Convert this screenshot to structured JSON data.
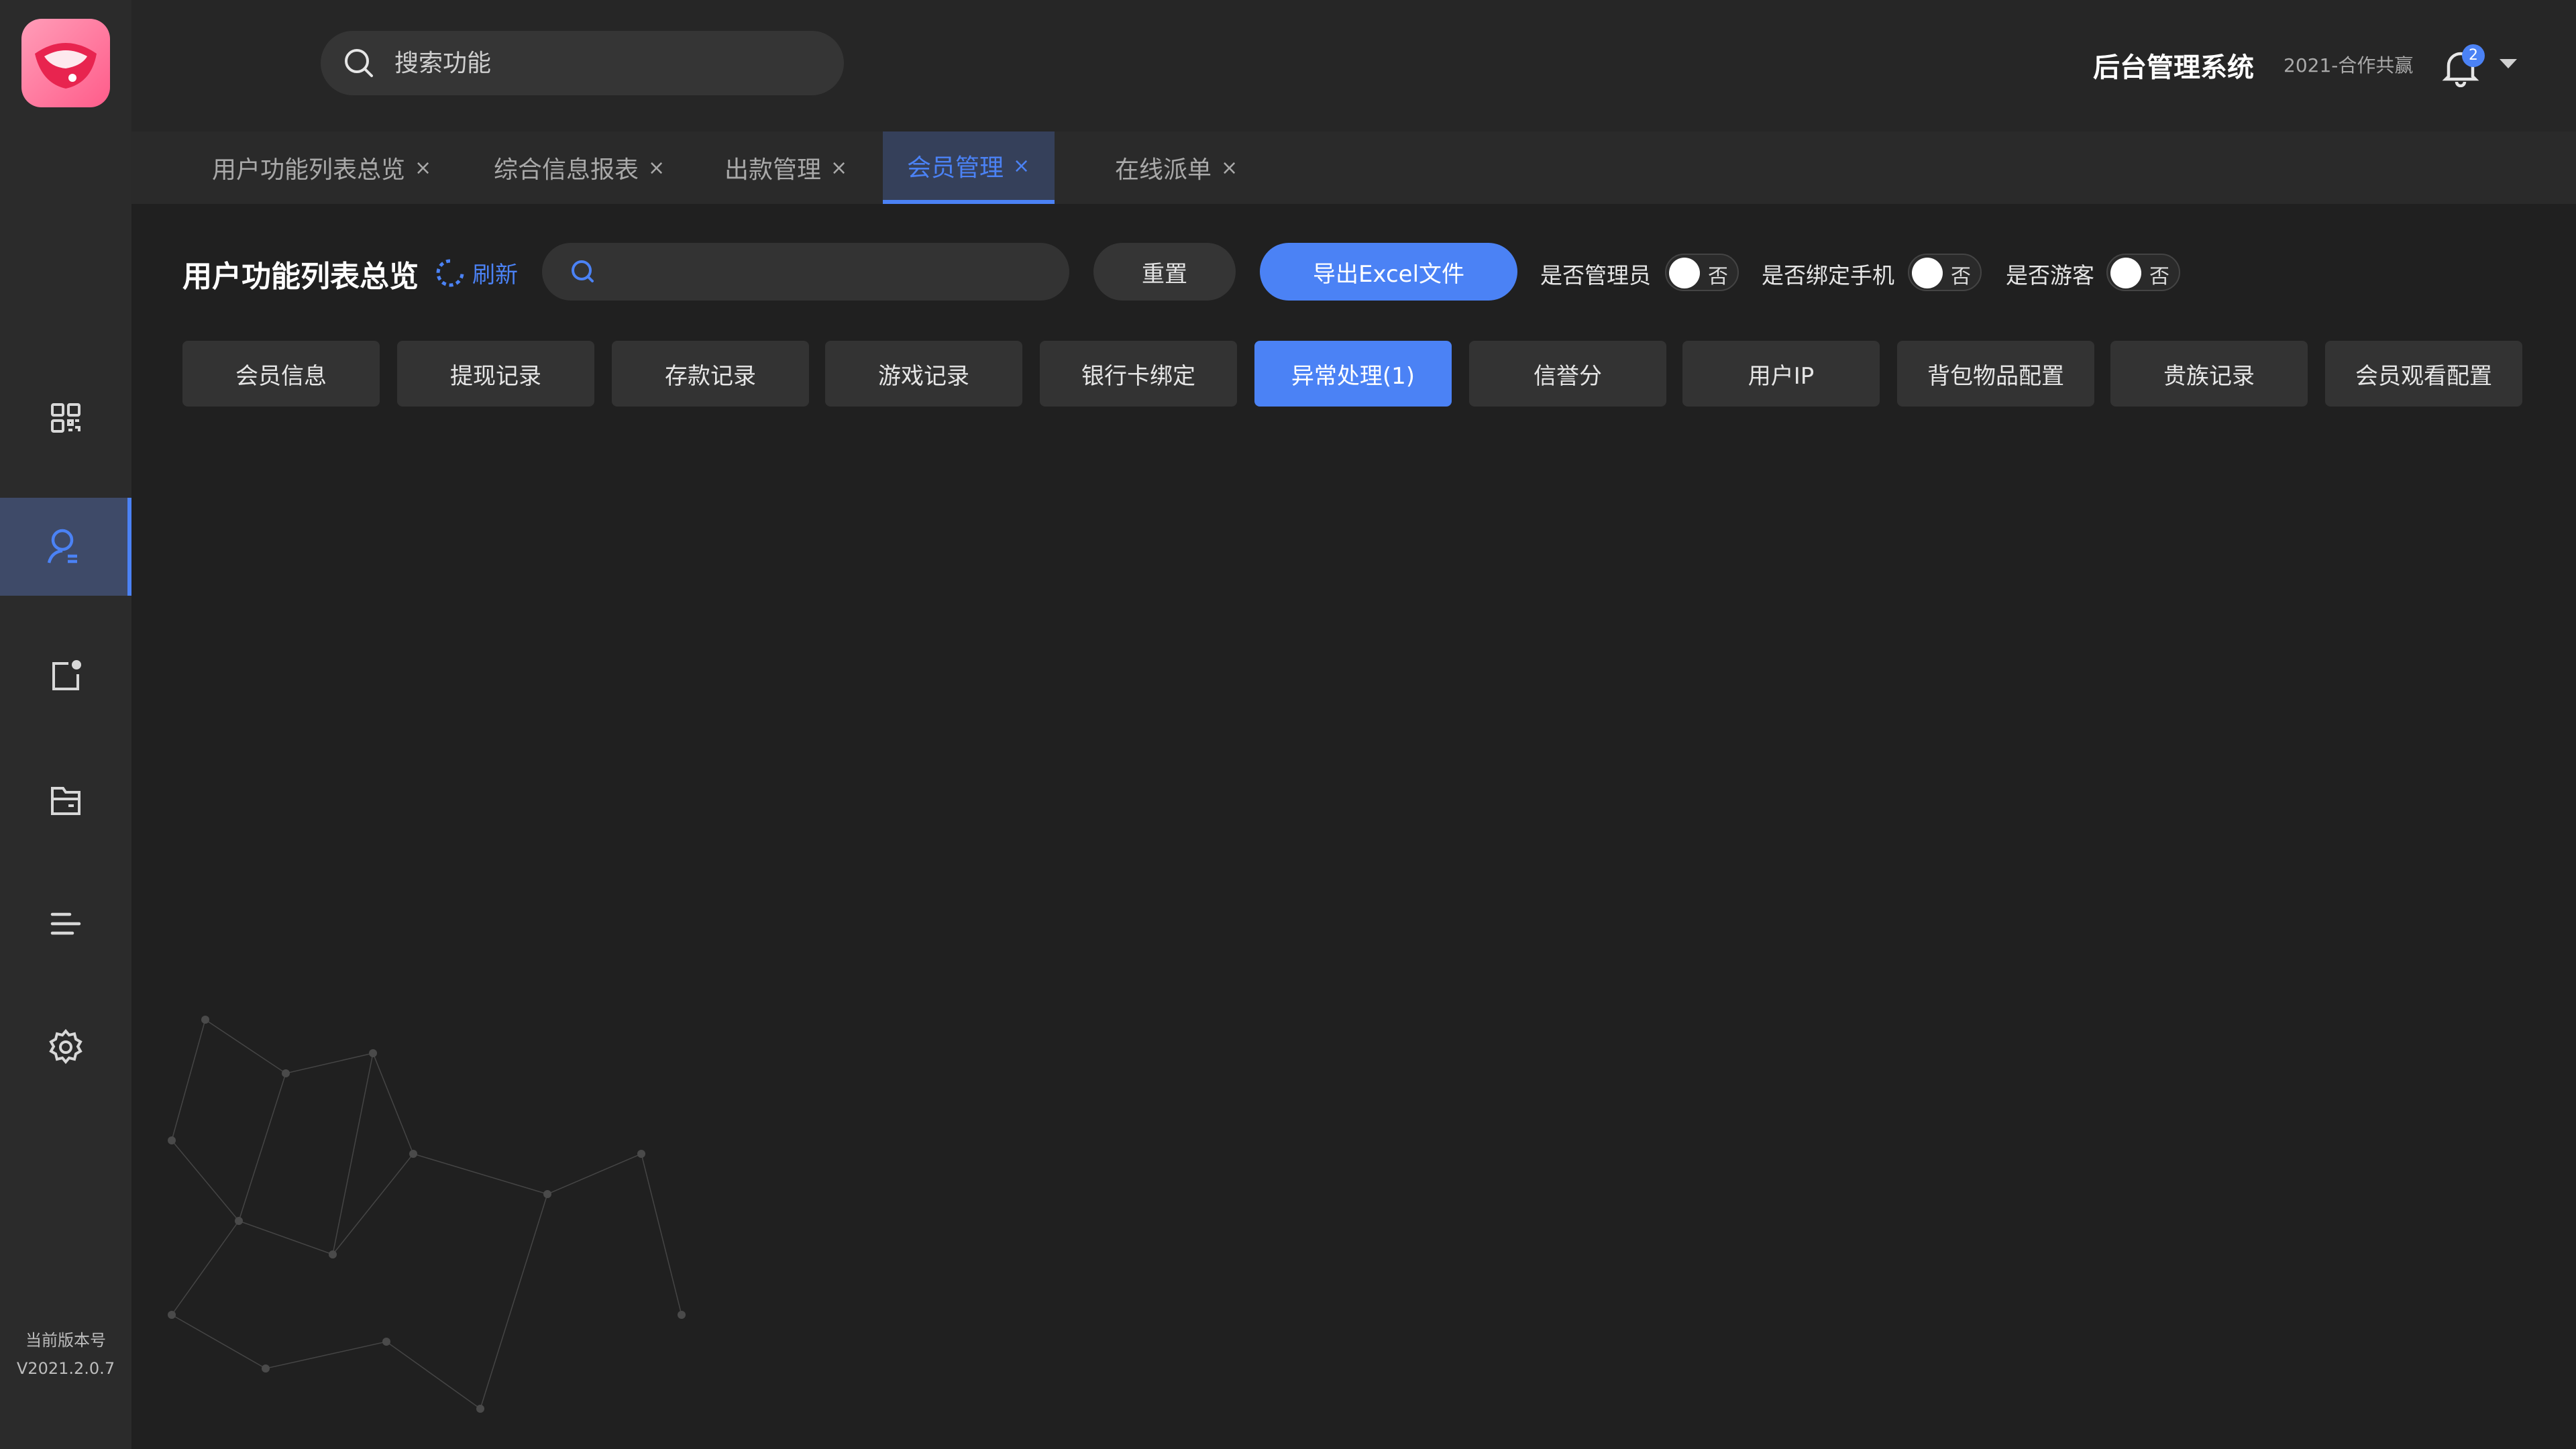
{
  "sidebar": {
    "logo": "brand-logo",
    "nav": [
      {
        "icon": "dashboard-icon",
        "active": false
      },
      {
        "icon": "user-icon",
        "active": true
      },
      {
        "icon": "note-icon",
        "active": false
      },
      {
        "icon": "folder-icon",
        "active": false
      },
      {
        "icon": "list-icon",
        "active": false
      },
      {
        "icon": "gear-icon",
        "active": false
      }
    ],
    "version_label": "当前版本号",
    "version_value": "V2021.2.0.7"
  },
  "header": {
    "search_placeholder": "搜索功能",
    "system_title": "后台管理系统",
    "system_subtitle": "2021-合作共赢",
    "notification_count": "2"
  },
  "tabs": [
    {
      "label": "用户功能列表总览",
      "close": "×"
    },
    {
      "label": "综合信息报表",
      "close": "×"
    },
    {
      "label": "出款管理",
      "close": "×"
    },
    {
      "label": "会员管理",
      "close": "×",
      "active": true
    },
    {
      "label": "在线派单",
      "close": "×"
    }
  ],
  "toolbar": {
    "page_title": "用户功能列表总览",
    "refresh_label": "刷新",
    "search_value": "",
    "reset_label": "重置",
    "export_label": "导出Excel文件",
    "filters": [
      {
        "label": "是否管理员",
        "value": "否"
      },
      {
        "label": "是否绑定手机",
        "value": "否"
      },
      {
        "label": "是否游客",
        "value": "否"
      }
    ]
  },
  "sections": [
    {
      "label": "会员信息"
    },
    {
      "label": "提现记录"
    },
    {
      "label": "存款记录"
    },
    {
      "label": "游戏记录"
    },
    {
      "label": "银行卡绑定"
    },
    {
      "label": "异常处理(1)",
      "active": true
    },
    {
      "label": "信誉分"
    },
    {
      "label": "用户IP"
    },
    {
      "label": "背包物品配置"
    },
    {
      "label": "贵族记录"
    },
    {
      "label": "会员观看配置"
    }
  ],
  "colors": {
    "accent": "#4b82f5",
    "background": "#202020",
    "sidebar": "#2b2b2b"
  }
}
